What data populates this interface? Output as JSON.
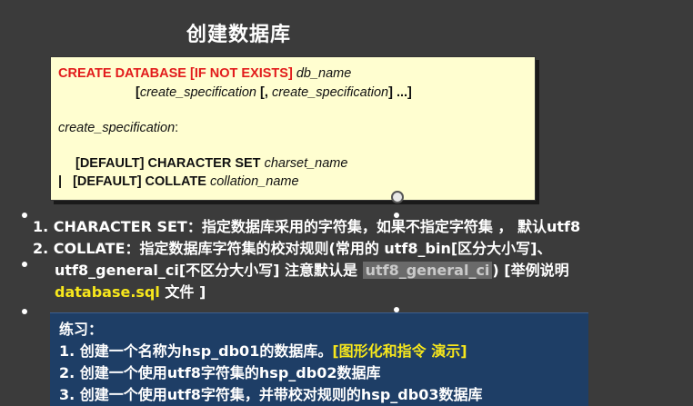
{
  "title": "创建数据库",
  "syntax": {
    "line1_keyword": "CREATE  DATABASE",
    "line1_optional": "[IF NOT EXISTS]",
    "line1_name": "db_name",
    "line2_open": "[",
    "line2_spec1": "create_specification",
    "line2_sep": " [, ",
    "line2_spec2": "create_specification",
    "line2_close": "] ...]",
    "line3_spec": "create_specification",
    "line3_colon": ":",
    "line4_default": "[DEFAULT] CHARACTER SET",
    "line4_name": "charset_name",
    "line5_pipe": "|",
    "line5_default": "[DEFAULT] COLLATE",
    "line5_name": "collation_name"
  },
  "notes": {
    "item1": "1. CHARACTER SET：指定数据库采用的字符集，如果不指定字符集 ， 默认utf8",
    "item2_a": "2. COLLATE：指定数据库字符集的校对规则(常用的 utf8_bin[区分大小写]、",
    "item2_b": "utf8_general_ci[不区分大小写] 注意默认是 ",
    "item2_b_highlight": "utf8_general_ci",
    "item2_b_tail": ") [举例说明",
    "item2_c_file": "database.sql",
    "item2_c_tail": " 文件 ]"
  },
  "exercise": {
    "title": "练习：",
    "item1_text": "1.  创建一个名称为hsp_db01的数据库。",
    "item1_highlight": "[图形化和指令 演示]",
    "item2": "2.  创建一个使用utf8字符集的hsp_db02数据库",
    "item3": "3.  创建一个使用utf8字符集，并带校对规则的hsp_db03数据库"
  },
  "colors": {
    "background": "#3b3b3b",
    "syntax_box": "#fffed0",
    "keyword_red": "#e21b1b",
    "highlight_yellow": "#f7e71c",
    "exercise_box": "#1e3e66"
  }
}
